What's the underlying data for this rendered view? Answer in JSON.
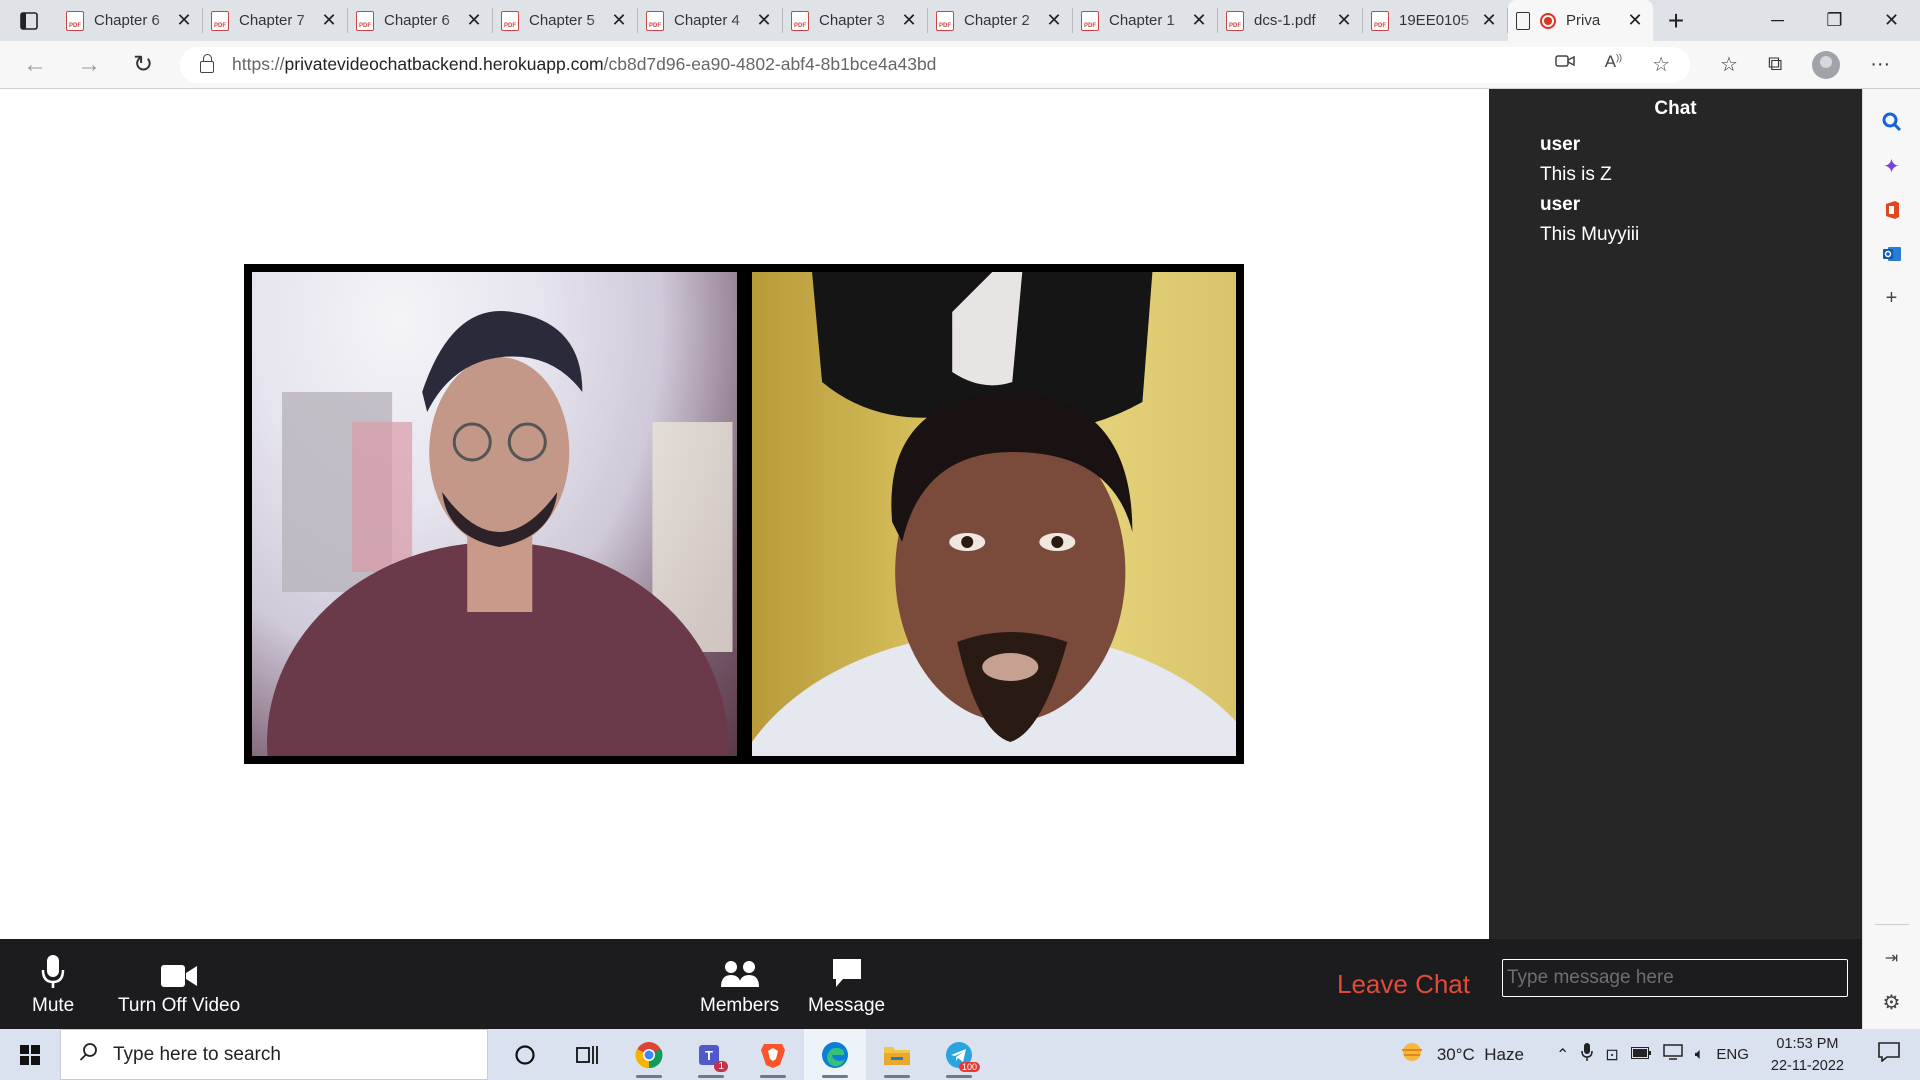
{
  "browser": {
    "tabs": [
      {
        "title": "Chapter 6",
        "active": false
      },
      {
        "title": "Chapter 7",
        "active": false
      },
      {
        "title": "Chapter 6",
        "active": false
      },
      {
        "title": "Chapter 5",
        "active": false
      },
      {
        "title": "Chapter 4",
        "active": false
      },
      {
        "title": "Chapter 3",
        "active": false
      },
      {
        "title": "Chapter 2",
        "active": false
      },
      {
        "title": "Chapter 1",
        "active": false
      },
      {
        "title": "dcs-1.pdf",
        "active": false
      },
      {
        "title": "19EE0105",
        "active": false
      },
      {
        "title": "Priva",
        "active": true
      }
    ],
    "new_tab_glyph": "+",
    "address": {
      "scheme": "https://",
      "host": "privatevideochatbackend.herokuapp.com",
      "path": "/cb8d7d96-ea90-4802-abf4-8b1bce4a43bd"
    }
  },
  "controls": {
    "mute_label": "Mute",
    "video_label": "Turn Off Video",
    "members_label": "Members",
    "message_label": "Message",
    "leave_label": "Leave Chat"
  },
  "chat": {
    "title": "Chat",
    "messages": [
      {
        "user": "user",
        "text": "This is Z"
      },
      {
        "user": "user",
        "text": "This Muyyiii"
      }
    ],
    "input_placeholder": "Type message here"
  },
  "taskbar": {
    "search_placeholder": "Type here to search",
    "weather": "30°C  Haze",
    "language": "ENG",
    "time": "01:53 PM",
    "date": "22-11-2022",
    "teams_badge": "1",
    "telegram_badge": "100"
  },
  "colors": {
    "leave_accent": "#e04b3a",
    "dark_bg": "#1c1c1f",
    "chat_bg": "#262626"
  }
}
